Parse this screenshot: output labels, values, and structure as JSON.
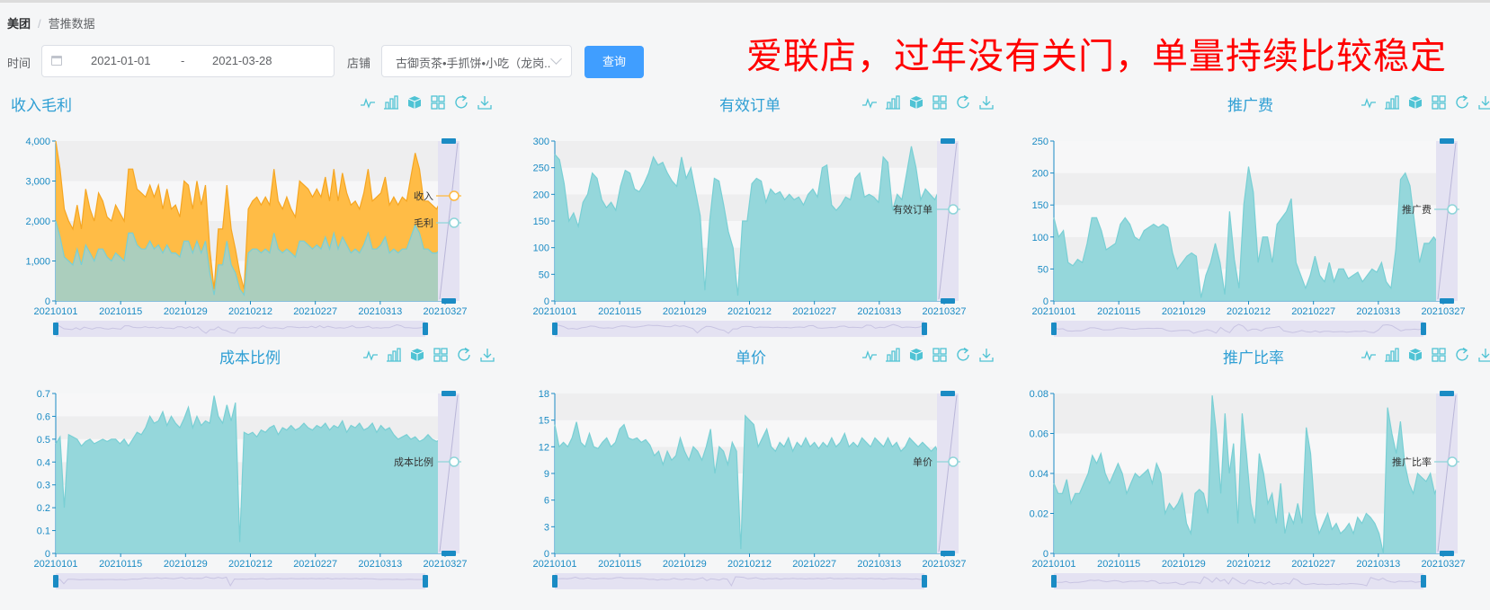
{
  "breadcrumb": {
    "root": "美团",
    "current": "营推数据"
  },
  "filters": {
    "time_label": "时间",
    "date_start": "2021-01-01",
    "date_separator": "-",
    "date_end": "2021-03-28",
    "store_label": "店铺",
    "store_value": "古御贡茶•手抓饼•小吃（龙岗...",
    "query_button": "查询"
  },
  "annotation": "爱联店，过年没有关门，单量持续比较稳定",
  "colors": {
    "teal": "#8fd5d9",
    "teal_line": "#79cfd4",
    "orange": "#ffb83c",
    "orange_line": "#f5a623",
    "axis": "#1a8bc4",
    "accent": "#409eff",
    "toolbar": "#4fc3d4"
  },
  "toolbar_icons": [
    "line-chart-icon",
    "bar-chart-icon",
    "stack-icon",
    "tiled-icon",
    "restore-icon",
    "download-icon"
  ],
  "chart_data": [
    {
      "id": "revenue",
      "type": "area",
      "title": "收入毛利",
      "x_ticks": [
        "20210101",
        "20210115",
        "20210129",
        "20210212",
        "20210227",
        "20210313",
        "20210327"
      ],
      "y_ticks": [
        "0",
        "1,000",
        "2,000",
        "3,000",
        "4,000"
      ],
      "ylim": [
        0,
        4000
      ],
      "series": [
        {
          "name": "收入",
          "color": "#ffb83c",
          "values": [
            4000,
            3300,
            2300,
            2000,
            1800,
            2400,
            1800,
            2800,
            2300,
            2000,
            2700,
            2500,
            2100,
            2000,
            2400,
            2200,
            2000,
            3300,
            3300,
            2800,
            2700,
            2600,
            2900,
            2600,
            2900,
            2300,
            2800,
            2300,
            2400,
            2100,
            3000,
            2900,
            2300,
            3000,
            2400,
            2900,
            1300,
            300,
            1800,
            1800,
            2900,
            1800,
            1300,
            700,
            300,
            2300,
            2500,
            2600,
            2400,
            2600,
            2400,
            3300,
            2500,
            2300,
            2600,
            2300,
            2100,
            3000,
            2900,
            2800,
            2600,
            2800,
            2600,
            3100,
            2500,
            3300,
            2500,
            3200,
            2700,
            2400,
            2500,
            2300,
            2700,
            3300,
            2500,
            2600,
            2700,
            3100,
            2400,
            2600,
            2400,
            2600,
            2500,
            3100,
            3700,
            3300,
            2500,
            2500,
            2400,
            2300,
            2500,
            3400
          ]
        },
        {
          "name": "毛利",
          "color": "#a7cfc4",
          "values": [
            2000,
            1600,
            1100,
            1000,
            900,
            1300,
            900,
            1400,
            1200,
            1000,
            1300,
            1300,
            1100,
            1000,
            1200,
            1100,
            1000,
            1700,
            1700,
            1400,
            1300,
            1300,
            1500,
            1300,
            1400,
            1200,
            1400,
            1200,
            1200,
            1100,
            1500,
            1500,
            1200,
            1500,
            1200,
            1500,
            700,
            150,
            900,
            900,
            1500,
            900,
            700,
            300,
            150,
            1200,
            1300,
            1300,
            1200,
            1300,
            1200,
            1700,
            1300,
            1200,
            1300,
            1200,
            1100,
            1500,
            1500,
            1400,
            1300,
            1400,
            1300,
            1600,
            1300,
            1700,
            1300,
            1600,
            1400,
            1200,
            1300,
            1200,
            1400,
            1700,
            1300,
            1300,
            1400,
            1600,
            1200,
            1300,
            1200,
            1300,
            1300,
            1600,
            1900,
            1700,
            1300,
            1300,
            1200,
            1200,
            1300,
            1700
          ]
        }
      ]
    },
    {
      "id": "orders",
      "type": "area",
      "title": "有效订单",
      "x_ticks": [
        "20210101",
        "20210115",
        "20210129",
        "20210212",
        "20210227",
        "20210313",
        "20210327"
      ],
      "y_ticks": [
        "0",
        "50",
        "100",
        "150",
        "200",
        "250",
        "300"
      ],
      "ylim": [
        0,
        300
      ],
      "series": [
        {
          "name": "有效订单",
          "color": "#8fd5d9",
          "values": [
            275,
            265,
            220,
            150,
            165,
            140,
            185,
            200,
            240,
            230,
            190,
            175,
            185,
            170,
            215,
            245,
            240,
            210,
            205,
            220,
            240,
            270,
            255,
            260,
            240,
            225,
            215,
            270,
            230,
            250,
            205,
            160,
            20,
            150,
            230,
            225,
            180,
            130,
            100,
            10,
            150,
            150,
            220,
            230,
            225,
            185,
            210,
            200,
            205,
            190,
            200,
            190,
            195,
            180,
            200,
            210,
            195,
            250,
            255,
            180,
            170,
            180,
            195,
            190,
            230,
            240,
            195,
            200,
            195,
            185,
            270,
            260,
            170,
            200,
            190,
            240,
            290,
            250,
            190,
            210,
            200,
            190,
            210,
            295
          ]
        }
      ]
    },
    {
      "id": "promo_fee",
      "type": "area",
      "title": "推广费",
      "x_ticks": [
        "20210101",
        "20210115",
        "20210129",
        "20210212",
        "20210227",
        "20210313",
        "20210327"
      ],
      "y_ticks": [
        "0",
        "50",
        "100",
        "150",
        "200",
        "250"
      ],
      "ylim": [
        0,
        250
      ],
      "series": [
        {
          "name": "推广费",
          "color": "#8fd5d9",
          "values": [
            130,
            100,
            110,
            60,
            55,
            65,
            60,
            90,
            130,
            130,
            110,
            80,
            85,
            90,
            120,
            130,
            120,
            100,
            95,
            110,
            115,
            120,
            115,
            120,
            115,
            75,
            50,
            60,
            70,
            75,
            70,
            5,
            40,
            60,
            90,
            60,
            10,
            140,
            65,
            20,
            150,
            210,
            170,
            60,
            100,
            100,
            60,
            120,
            130,
            140,
            160,
            60,
            40,
            20,
            40,
            70,
            40,
            30,
            60,
            30,
            50,
            50,
            35,
            40,
            45,
            30,
            40,
            50,
            45,
            60,
            30,
            20,
            80,
            190,
            200,
            180,
            120,
            60,
            90,
            90,
            100,
            90,
            120
          ]
        }
      ]
    },
    {
      "id": "cost_ratio",
      "type": "area",
      "title": "成本比例",
      "x_ticks": [
        "20210101",
        "20210115",
        "20210129",
        "20210212",
        "20210227",
        "20210313",
        "20210327"
      ],
      "y_ticks": [
        "0",
        "0.1",
        "0.2",
        "0.3",
        "0.4",
        "0.5",
        "0.6",
        "0.7"
      ],
      "ylim": [
        0,
        0.7
      ],
      "series": [
        {
          "name": "成本比例",
          "color": "#8fd5d9",
          "values": [
            0.48,
            0.51,
            0.2,
            0.52,
            0.51,
            0.5,
            0.47,
            0.49,
            0.5,
            0.48,
            0.49,
            0.5,
            0.49,
            0.5,
            0.5,
            0.48,
            0.5,
            0.47,
            0.5,
            0.53,
            0.52,
            0.55,
            0.6,
            0.57,
            0.58,
            0.62,
            0.56,
            0.6,
            0.57,
            0.55,
            0.59,
            0.64,
            0.55,
            0.6,
            0.56,
            0.58,
            0.57,
            0.69,
            0.6,
            0.57,
            0.65,
            0.58,
            0.66,
            0.05,
            0.53,
            0.52,
            0.53,
            0.51,
            0.54,
            0.53,
            0.55,
            0.56,
            0.52,
            0.55,
            0.54,
            0.56,
            0.54,
            0.55,
            0.57,
            0.55,
            0.54,
            0.56,
            0.55,
            0.57,
            0.54,
            0.56,
            0.55,
            0.58,
            0.53,
            0.56,
            0.55,
            0.57,
            0.54,
            0.55,
            0.57,
            0.53,
            0.56,
            0.54,
            0.55,
            0.52,
            0.5,
            0.51,
            0.52,
            0.5,
            0.51,
            0.49,
            0.5,
            0.52,
            0.5,
            0.49,
            0.5,
            0.52
          ]
        }
      ]
    },
    {
      "id": "unit_price",
      "type": "area",
      "title": "单价",
      "x_ticks": [
        "20210101",
        "20210115",
        "20210129",
        "20210212",
        "20210227",
        "20210313",
        "20210327"
      ],
      "y_ticks": [
        "0",
        "3",
        "6",
        "9",
        "12",
        "15",
        "18"
      ],
      "ylim": [
        0,
        18
      ],
      "series": [
        {
          "name": "单价",
          "color": "#8fd5d9",
          "values": [
            14.5,
            12,
            12.5,
            12,
            13,
            14.8,
            12.5,
            12,
            13.5,
            12,
            11.8,
            12.5,
            13,
            12,
            12.5,
            14,
            14.5,
            13,
            12.8,
            13,
            12.5,
            12.8,
            12.2,
            11,
            11.5,
            10,
            11.5,
            10.5,
            11,
            13,
            11.5,
            10.5,
            12,
            11.5,
            10.5,
            12,
            14,
            9,
            12,
            11.5,
            10,
            12.5,
            11.5,
            0.5,
            15.5,
            15,
            14.5,
            12,
            13,
            14,
            12,
            11.5,
            12.5,
            12,
            13,
            11.5,
            12.5,
            12,
            13,
            12,
            12.5,
            11.8,
            12.5,
            12,
            13,
            12,
            12.5,
            13.5,
            12,
            12.5,
            12,
            13,
            12.5,
            12,
            13,
            12.5,
            12,
            13,
            12,
            12.5,
            11.5,
            12,
            13,
            12.5,
            12,
            12.5,
            12,
            11.5,
            12,
            11,
            11.5
          ]
        }
      ]
    },
    {
      "id": "promo_ratio",
      "type": "area",
      "title": "推广比率",
      "x_ticks": [
        "20210101",
        "20210115",
        "20210129",
        "20210212",
        "20210227",
        "20210313",
        "20210327"
      ],
      "y_ticks": [
        "0",
        "0.02",
        "0.04",
        "0.06",
        "0.08"
      ],
      "ylim": [
        0,
        0.08
      ],
      "series": [
        {
          "name": "推广比率",
          "color": "#8fd5d9",
          "values": [
            0.035,
            0.03,
            0.03,
            0.037,
            0.025,
            0.03,
            0.03,
            0.035,
            0.04,
            0.049,
            0.045,
            0.05,
            0.04,
            0.035,
            0.04,
            0.045,
            0.04,
            0.03,
            0.035,
            0.04,
            0.038,
            0.04,
            0.042,
            0.035,
            0.045,
            0.04,
            0.02,
            0.025,
            0.022,
            0.025,
            0.03,
            0.015,
            0.01,
            0.03,
            0.032,
            0.03,
            0.02,
            0.079,
            0.06,
            0.03,
            0.07,
            0.04,
            0.055,
            0.015,
            0.07,
            0.05,
            0.025,
            0.015,
            0.05,
            0.04,
            0.025,
            0.03,
            0.015,
            0.035,
            0.01,
            0.02,
            0.015,
            0.025,
            0.015,
            0.063,
            0.05,
            0.02,
            0.01,
            0.015,
            0.02,
            0.012,
            0.015,
            0.01,
            0.012,
            0.015,
            0.01,
            0.018,
            0.015,
            0.02,
            0.018,
            0.015,
            0.01,
            0.0,
            0.073,
            0.06,
            0.05,
            0.066,
            0.045,
            0.035,
            0.03,
            0.04,
            0.038,
            0.036,
            0.04,
            0.03,
            0.035,
            0.037
          ]
        }
      ]
    }
  ]
}
